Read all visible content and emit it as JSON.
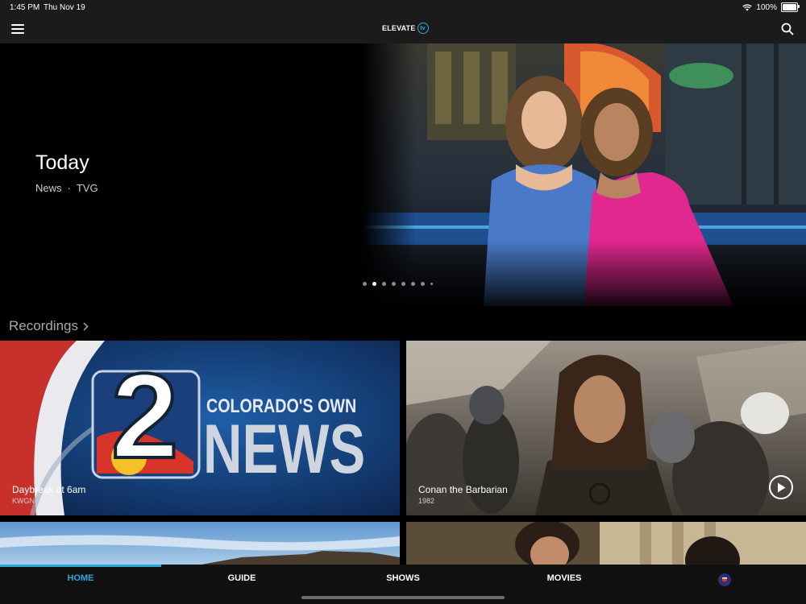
{
  "status": {
    "time": "1:45 PM",
    "date": "Thu Nov 19",
    "battery": "100%"
  },
  "header": {
    "logo_text": "ELEVATE",
    "logo_badge": "tv"
  },
  "hero": {
    "title": "Today",
    "genre": "News",
    "separator": "·",
    "rating": "TVG",
    "dots_total": 8,
    "dots_active": 2
  },
  "recordings": {
    "header": "Recordings",
    "items": [
      {
        "title": "Daybreak at 6am",
        "subtitle": "KWGN",
        "art_text_top": "COLORADO'S OWN",
        "art_text_big": "NEWS",
        "art_numeral": "2"
      },
      {
        "title": "Conan the Barbarian",
        "subtitle": "1982"
      }
    ]
  },
  "tabs": {
    "home": "HOME",
    "guide": "GUIDE",
    "shows": "SHOWS",
    "movies": "MOVIES"
  },
  "colors": {
    "accent": "#2aa9d8",
    "background": "#000000",
    "bar": "#1b1b1b"
  }
}
